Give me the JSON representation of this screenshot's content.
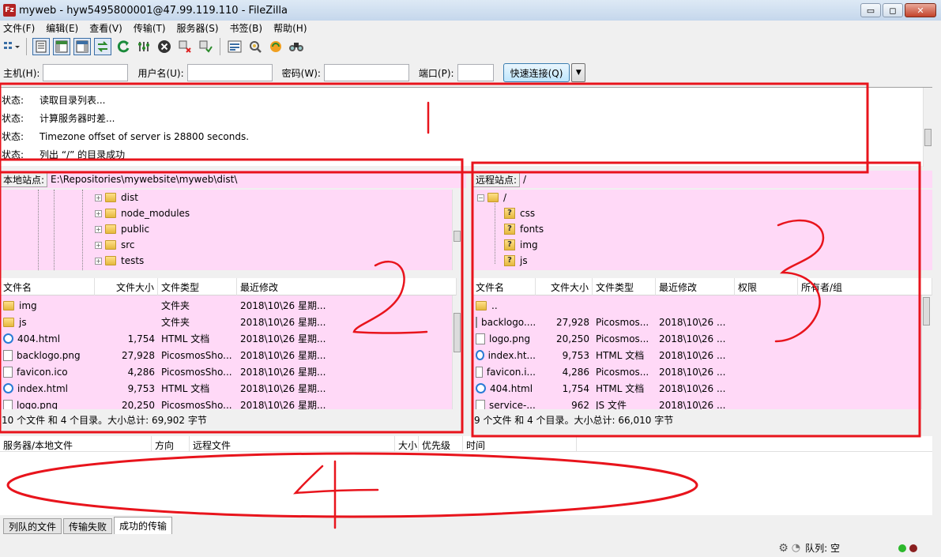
{
  "window": {
    "title": "myweb - hyw5495800001@47.99.119.110 - FileZilla",
    "app_icon_text": "Fz",
    "minimize": "▭",
    "maximize": "◻",
    "close": "✕"
  },
  "menu": [
    "文件(F)",
    "编辑(E)",
    "查看(V)",
    "传输(T)",
    "服务器(S)",
    "书签(B)",
    "帮助(H)"
  ],
  "toolbar_icons": [
    "site-manager-icon",
    "message-log-icon",
    "local-tree-icon",
    "remote-tree-icon",
    "transfer-queue-icon",
    "refresh-icon",
    "process-queue-icon",
    "cancel-icon",
    "disconnect-icon",
    "reconnect-icon",
    "filter-icon",
    "compare-icon",
    "sync-icon",
    "search-icon"
  ],
  "quickconnect": {
    "host_label": "主机(H):",
    "user_label": "用户名(U):",
    "pass_label": "密码(W):",
    "port_label": "端口(P):",
    "host_value": "",
    "user_value": "",
    "pass_value": "",
    "port_value": "",
    "button": "快速连接(Q)",
    "dropdown": "▼"
  },
  "log": [
    {
      "k": "状态:",
      "v": "读取目录列表..."
    },
    {
      "k": "状态:",
      "v": "计算服务器时差..."
    },
    {
      "k": "状态:",
      "v": "Timezone offset of server is 28800 seconds."
    },
    {
      "k": "状态:",
      "v": "列出 “/” 的目录成功"
    }
  ],
  "local": {
    "site_label": "本地站点:",
    "path": "E:\\Repositories\\mywebsite\\myweb\\dist\\",
    "tree": [
      "dist",
      "node_modules",
      "public",
      "src",
      "tests"
    ],
    "columns": [
      "文件名",
      "文件大小",
      "文件类型",
      "最近修改"
    ],
    "files": [
      {
        "name": "img",
        "size": "",
        "type": "文件夹",
        "mod": "2018\\10\\26 星期...",
        "icon": "folder"
      },
      {
        "name": "js",
        "size": "",
        "type": "文件夹",
        "mod": "2018\\10\\26 星期...",
        "icon": "folder"
      },
      {
        "name": "404.html",
        "size": "1,754",
        "type": "HTML 文档",
        "mod": "2018\\10\\26 星期...",
        "icon": "html"
      },
      {
        "name": "backlogo.png",
        "size": "27,928",
        "type": "PicosmosSho...",
        "mod": "2018\\10\\26 星期...",
        "icon": "file"
      },
      {
        "name": "favicon.ico",
        "size": "4,286",
        "type": "PicosmosSho...",
        "mod": "2018\\10\\26 星期...",
        "icon": "file"
      },
      {
        "name": "index.html",
        "size": "9,753",
        "type": "HTML 文档",
        "mod": "2018\\10\\26 星期...",
        "icon": "html"
      },
      {
        "name": "logo.png",
        "size": "20,250",
        "type": "PicosmosSho...",
        "mod": "2018\\10\\26 星期...",
        "icon": "file"
      }
    ],
    "status": "10 个文件 和 4 个目录。大小总计: 69,902 字节"
  },
  "remote": {
    "site_label": "远程站点:",
    "path": "/",
    "root": "/",
    "tree": [
      "css",
      "fonts",
      "img",
      "js"
    ],
    "columns": [
      "文件名",
      "文件大小",
      "文件类型",
      "最近修改",
      "权限",
      "所有者/组"
    ],
    "files": [
      {
        "name": "..",
        "size": "",
        "type": "",
        "mod": "",
        "icon": "folder"
      },
      {
        "name": "backlogo....",
        "size": "27,928",
        "type": "Picosmos...",
        "mod": "2018\\10\\26 ...",
        "icon": "file"
      },
      {
        "name": "logo.png",
        "size": "20,250",
        "type": "Picosmos...",
        "mod": "2018\\10\\26 ...",
        "icon": "file"
      },
      {
        "name": "index.ht...",
        "size": "9,753",
        "type": "HTML 文档",
        "mod": "2018\\10\\26 ...",
        "icon": "html"
      },
      {
        "name": "favicon.i...",
        "size": "4,286",
        "type": "Picosmos...",
        "mod": "2018\\10\\26 ...",
        "icon": "file"
      },
      {
        "name": "404.html",
        "size": "1,754",
        "type": "HTML 文档",
        "mod": "2018\\10\\26 ...",
        "icon": "html"
      },
      {
        "name": "service-...",
        "size": "962",
        "type": "JS 文件",
        "mod": "2018\\10\\26 ...",
        "icon": "file"
      }
    ],
    "status": "9 个文件 和 4 个目录。大小总计: 66,010 字节"
  },
  "queue": {
    "columns": [
      "服务器/本地文件",
      "方向",
      "远程文件",
      "大小",
      "优先级",
      "时间"
    ],
    "tabs": [
      "列队的文件",
      "传输失败",
      "成功的传输"
    ],
    "active_tab": 2
  },
  "status_bar": {
    "queue": "队列: 空"
  },
  "annotations": [
    "1",
    "2",
    "3",
    "4"
  ],
  "colors": {
    "highlight": "#ffd9f7",
    "annotation": "#e8141c"
  }
}
